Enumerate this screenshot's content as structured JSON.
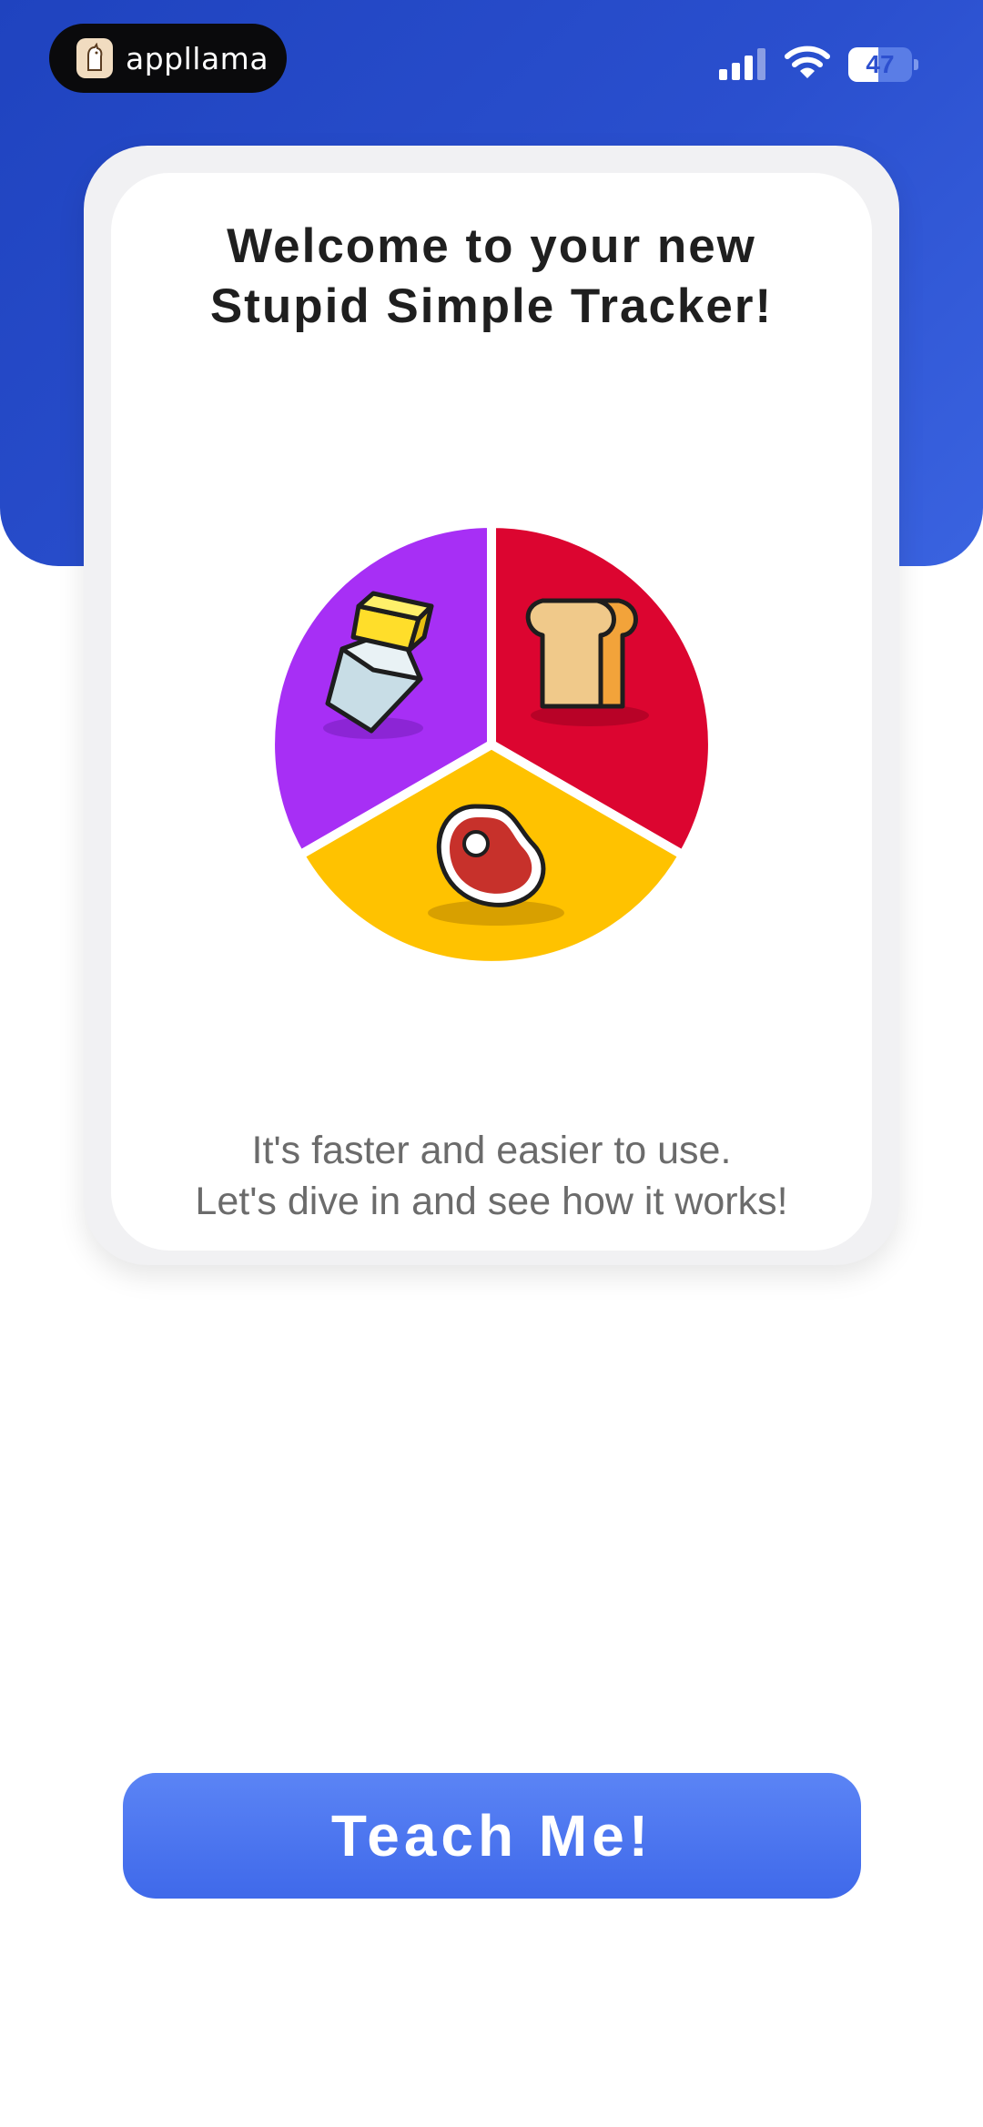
{
  "status_bar": {
    "app_badge": "appllama",
    "battery": "47",
    "battery_level": 0.47,
    "icons": [
      "cellular-signal-icon",
      "wifi-icon",
      "battery-icon"
    ]
  },
  "welcome": {
    "title": "Welcome to your new\nStupid Simple Tracker!",
    "subtitle": "It's faster and easier to use.\nLet's dive in and see how it works!",
    "illustration": {
      "segments": [
        {
          "icon": "butter-icon",
          "color": "#a72ff5"
        },
        {
          "icon": "bread-icon",
          "color": "#dc0530"
        },
        {
          "icon": "steak-icon",
          "color": "#ffc200"
        }
      ]
    }
  },
  "actions": {
    "teach_label": "Teach Me!"
  },
  "colors": {
    "header": "#2447c4",
    "button": "#4a74f0",
    "title_text": "#1f1f1f",
    "subtitle_text": "#6b6b6b"
  }
}
